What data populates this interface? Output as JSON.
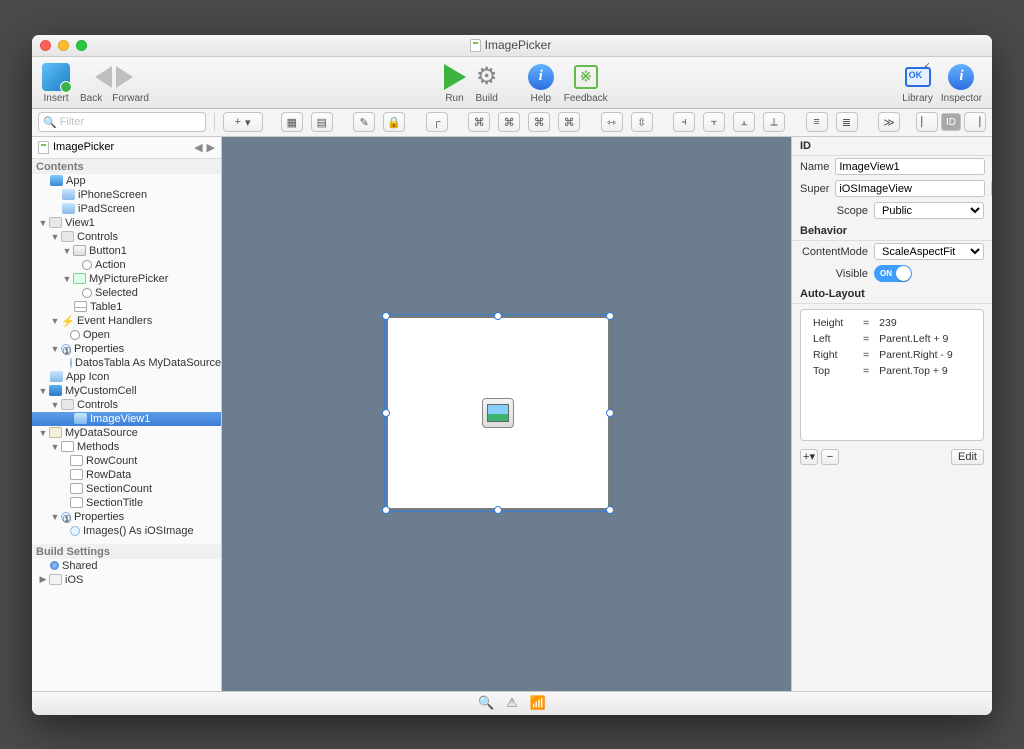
{
  "title": "ImagePicker",
  "toolbar": {
    "insert": "Insert",
    "back": "Back",
    "forward": "Forward",
    "run": "Run",
    "build": "Build",
    "help": "Help",
    "feedback": "Feedback",
    "library": "Library",
    "inspector": "Inspector",
    "filter_placeholder": "Filter",
    "add_btn": "+",
    "drop_btn": "▾"
  },
  "navigator": {
    "header": "ImagePicker",
    "sections": {
      "contents": "Contents",
      "build": "Build Settings"
    },
    "items": {
      "app": "App",
      "iphone": "iPhoneScreen",
      "ipad": "iPadScreen",
      "view1": "View1",
      "controls": "Controls",
      "button1": "Button1",
      "action": "Action",
      "picker": "MyPicturePicker",
      "selected": "Selected",
      "table1": "Table1",
      "ehandlers": "Event Handlers",
      "open": "Open",
      "props": "Properties",
      "datos": "DatosTabla As MyDataSource",
      "appicon": "App Icon",
      "mycell": "MyCustomCell",
      "controls2": "Controls",
      "imageview1": "ImageView1",
      "myds": "MyDataSource",
      "methods": "Methods",
      "rowcount": "RowCount",
      "rowdata": "RowData",
      "sectioncount": "SectionCount",
      "sectiontitle": "SectionTitle",
      "props2": "Properties",
      "images": "Images() As iOSImage",
      "shared": "Shared",
      "ios": "iOS"
    }
  },
  "inspector": {
    "id_head": "ID",
    "behavior_head": "Behavior",
    "autolayout_head": "Auto-Layout",
    "labels": {
      "name": "Name",
      "super": "Super",
      "scope": "Scope",
      "contentmode": "ContentMode",
      "visible": "Visible"
    },
    "values": {
      "name": "ImageView1",
      "super": "iOSImageView",
      "scope": "Public",
      "contentmode": "ScaleAspectFit",
      "visible": "ON"
    },
    "constraints": [
      {
        "prop": "Height",
        "val": "239"
      },
      {
        "prop": "Left",
        "val": "Parent.Left + 9"
      },
      {
        "prop": "Right",
        "val": "Parent.Right - 9"
      },
      {
        "prop": "Top",
        "val": "Parent.Top + 9"
      }
    ],
    "edit": "Edit"
  }
}
